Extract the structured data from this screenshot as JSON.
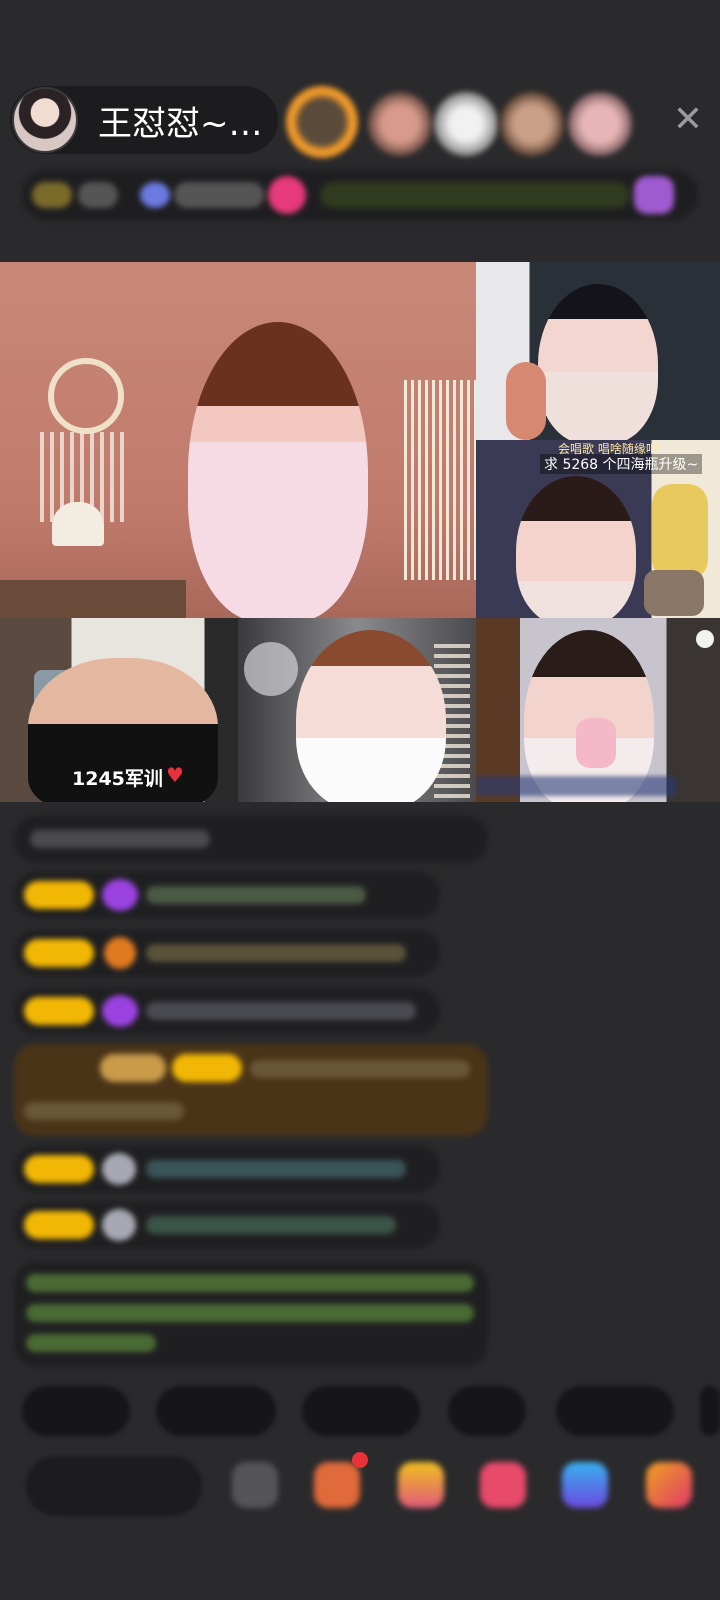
{
  "header": {
    "host_name": "王怼怼~…",
    "avatar_icon": "host-avatar",
    "close_icon": "close-icon"
  },
  "video": {
    "tile_overlay_top": "会唱歌  唱啥随缘吧",
    "tile_overlay_main": "求 5268 个四海瓶升级~",
    "badge_text": "1245军训"
  },
  "colors": {
    "background": "#2a2a2c",
    "gold_badge": "#f2b705",
    "green_text": "#8dbf3f",
    "purple_gem": "#9a42e0",
    "highlight_bg": "#5a3f1a"
  }
}
